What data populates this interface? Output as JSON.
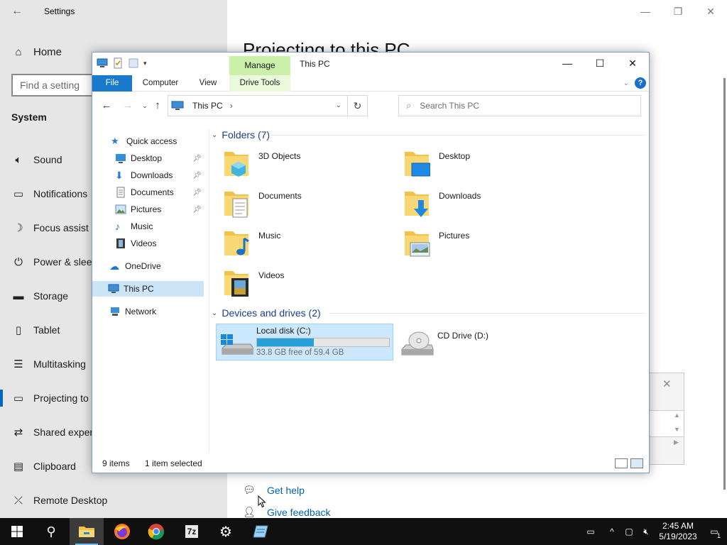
{
  "settings": {
    "title": "Settings",
    "home": "Home",
    "find_placeholder": "Find a setting",
    "section": "System",
    "items": [
      {
        "label": "Sound",
        "icon": "speaker-icon"
      },
      {
        "label": "Notifications",
        "icon": "notification-icon"
      },
      {
        "label": "Focus assist",
        "icon": "moon-icon"
      },
      {
        "label": "Power & sleep",
        "icon": "power-icon"
      },
      {
        "label": "Storage",
        "icon": "storage-icon"
      },
      {
        "label": "Tablet",
        "icon": "tablet-icon"
      },
      {
        "label": "Multitasking",
        "icon": "multitasking-icon"
      },
      {
        "label": "Projecting to this PC",
        "icon": "projecting-icon"
      },
      {
        "label": "Shared experiences",
        "icon": "shared-icon"
      },
      {
        "label": "Clipboard",
        "icon": "clipboard-icon"
      },
      {
        "label": "Remote Desktop",
        "icon": "remote-desktop-icon"
      }
    ],
    "page_title": "Projecting to this PC",
    "get_help": "Get help",
    "give_feedback": "Give feedback"
  },
  "explorer": {
    "title": "This PC",
    "manage_tab": "Manage",
    "ribbon_tabs": [
      "File",
      "Computer",
      "View",
      "Drive Tools"
    ],
    "address": {
      "crumb": "This PC",
      "separator": "›"
    },
    "search_placeholder": "Search This PC",
    "nav": {
      "quick_access": "Quick access",
      "pinned": [
        {
          "label": "Desktop",
          "pinned": true
        },
        {
          "label": "Downloads",
          "pinned": true
        },
        {
          "label": "Documents",
          "pinned": true
        },
        {
          "label": "Pictures",
          "pinned": true
        },
        {
          "label": "Music",
          "pinned": false
        },
        {
          "label": "Videos",
          "pinned": false
        }
      ],
      "onedrive": "OneDrive",
      "this_pc": "This PC",
      "network": "Network"
    },
    "folders_header": "Folders (7)",
    "folders": [
      {
        "name": "3D Objects",
        "overlay": "cube"
      },
      {
        "name": "Desktop",
        "overlay": "monitor"
      },
      {
        "name": "Documents",
        "overlay": "document"
      },
      {
        "name": "Downloads",
        "overlay": "arrow"
      },
      {
        "name": "Music",
        "overlay": "note"
      },
      {
        "name": "Pictures",
        "overlay": "photo"
      },
      {
        "name": "Videos",
        "overlay": "film"
      }
    ],
    "drives_header": "Devices and drives (2)",
    "drives": [
      {
        "name": "Local disk (C:)",
        "free": "33.8 GB free of 59.4 GB",
        "used_fraction": 0.431,
        "selected": true
      },
      {
        "name": "CD Drive (D:)"
      }
    ],
    "status": {
      "items": "9 items",
      "selected": "1 item selected"
    }
  },
  "taskbar": {
    "time": "2:45 AM",
    "date": "5/19/2023",
    "notification_count": "1"
  },
  "colors": {
    "accent": "#0067c0",
    "selection": "#cce8ff",
    "manage": "#cbf0a9",
    "drive_fill": "#26a0da"
  }
}
